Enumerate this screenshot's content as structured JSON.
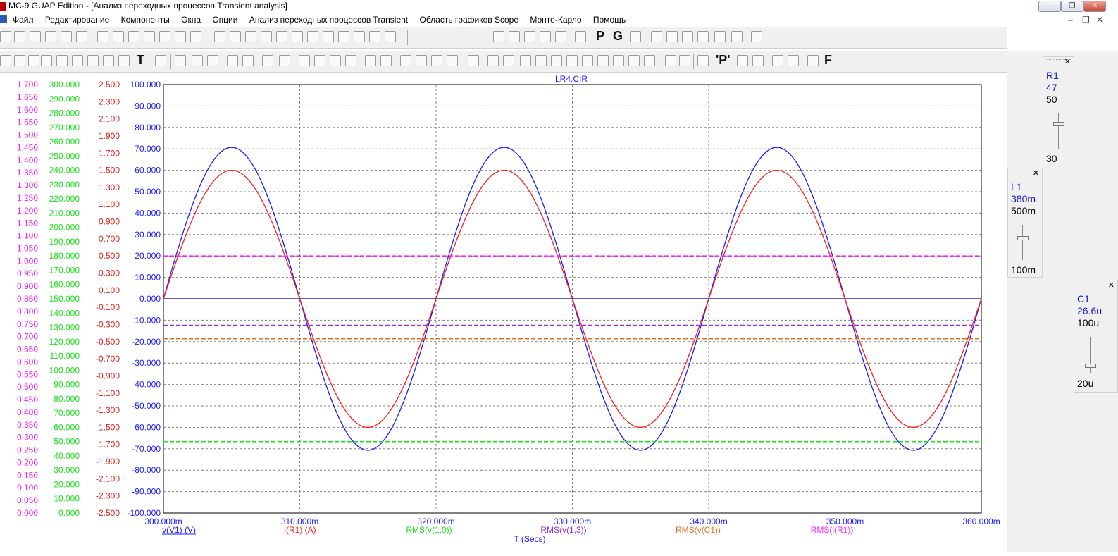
{
  "window": {
    "title": "MC-9 GUAP Edition - [Анализ переходных процессов Transient analysis]",
    "controls": [
      "—",
      "❐",
      "✕"
    ],
    "mdi_controls": [
      "–",
      "❐",
      "✕"
    ]
  },
  "menu": {
    "items": [
      "Файл",
      "Редактирование",
      "Компоненты",
      "Окна",
      "Опции",
      "Анализ переходных процессов Transient",
      "Область графиков Scope",
      "Монте-Карло",
      "Помощь"
    ]
  },
  "toolbar2_glyphs": {
    "text_tool": "T",
    "p_button": "P",
    "g_button": "G",
    "p_prime_button": "'P'",
    "f_button": "F"
  },
  "colors": {
    "blue": "#1a1aff",
    "red": "#ff1a1a",
    "green": "#20e020",
    "magenta": "#ff20ff",
    "orange": "#e07020",
    "purple": "#9030e0",
    "dark_red": "#e02020",
    "grid": "#808080"
  },
  "chart_data": {
    "type": "line",
    "title": "LR4.CIR",
    "xlabel": "T (Secs)",
    "xlim": [
      300,
      360
    ],
    "x_unit": "m",
    "x_ticks": [
      "300.000m",
      "310.000m",
      "320.000m",
      "330.000m",
      "340.000m",
      "350.000m",
      "360.000m"
    ],
    "axes": {
      "blue_V": {
        "range": [
          -100,
          100
        ],
        "ticks": [
          "100.000",
          "90.000",
          "80.000",
          "70.000",
          "60.000",
          "50.000",
          "40.000",
          "30.000",
          "20.000",
          "10.000",
          "0.000",
          "-10.000",
          "-20.000",
          "-30.000",
          "-40.000",
          "-50.000",
          "-60.000",
          "-70.000",
          "-80.000",
          "-90.000",
          "-100.000"
        ]
      },
      "red_A": {
        "range": [
          -2.5,
          2.5
        ],
        "ticks": [
          "2.500",
          "2.300",
          "2.100",
          "1.900",
          "1.700",
          "1.500",
          "1.300",
          "1.100",
          "0.900",
          "0.700",
          "0.500",
          "0.300",
          "0.100",
          "-0.100",
          "-0.300",
          "-0.500",
          "-0.700",
          "-0.900",
          "-1.100",
          "-1.300",
          "-1.500",
          "-1.700",
          "-1.900",
          "-2.100",
          "-2.300",
          "-2.500"
        ]
      },
      "green_RMS_V": {
        "range": [
          0,
          300
        ],
        "ticks": [
          "300.000",
          "290.000",
          "280.000",
          "270.000",
          "260.000",
          "250.000",
          "240.000",
          "230.000",
          "220.000",
          "210.000",
          "200.000",
          "190.000",
          "180.000",
          "170.000",
          "160.000",
          "150.000",
          "140.000",
          "130.000",
          "120.000",
          "110.000",
          "100.000",
          "90.000",
          "80.000",
          "70.000",
          "60.000",
          "50.000",
          "40.000",
          "30.000",
          "20.000",
          "10.000",
          "0.000"
        ]
      },
      "magenta_RMS_A": {
        "range": [
          0,
          1.7
        ],
        "ticks": [
          "1.700",
          "1.650",
          "1.600",
          "1.550",
          "1.500",
          "1.450",
          "1.400",
          "1.350",
          "1.300",
          "1.250",
          "1.200",
          "1.150",
          "1.100",
          "1.050",
          "1.000",
          "0.950",
          "0.900",
          "0.850",
          "0.800",
          "0.750",
          "0.700",
          "0.650",
          "0.600",
          "0.550",
          "0.500",
          "0.450",
          "0.400",
          "0.350",
          "0.300",
          "0.250",
          "0.200",
          "0.150",
          "0.100",
          "0.050",
          "0.000"
        ]
      }
    },
    "series": [
      {
        "name": "v(V1) (V)",
        "kind": "sine",
        "axis": "blue_V",
        "amplitude": 70.7,
        "period_ms": 20,
        "phase_ref_ms": 300,
        "color": "#1a1aff"
      },
      {
        "name": "i(R1) (A)",
        "kind": "sine",
        "axis": "red_A",
        "amplitude": 1.5,
        "period_ms": 20,
        "phase_ref_ms": 300,
        "color": "#ff1a1a"
      },
      {
        "name": "RMS(v(1,0))",
        "kind": "dashed_level",
        "axis": "green_RMS_V",
        "value": 50,
        "color": "#20e020"
      },
      {
        "name": "RMS(v(1,3))",
        "kind": "dashed_level",
        "axis": "green_RMS_V",
        "value": 131.5,
        "color": "#9030e0"
      },
      {
        "name": "RMS(v(C1))",
        "kind": "dashed_level",
        "axis": "green_RMS_V",
        "value": 122,
        "color": "#e07020"
      },
      {
        "name": "RMS(i(R1))",
        "kind": "dashed_level",
        "axis": "magenta_RMS_A",
        "value": 1.02,
        "color": "#ff20ff"
      }
    ],
    "grid": true,
    "legend": "bottom"
  },
  "sliders": [
    {
      "name": "R1",
      "value": "47",
      "max": "50",
      "min": "30"
    },
    {
      "name": "L1",
      "value": "380m",
      "max": "500m",
      "min": "100m"
    },
    {
      "name": "C1",
      "value": "26.6u",
      "max": "100u",
      "min": "20u"
    }
  ]
}
